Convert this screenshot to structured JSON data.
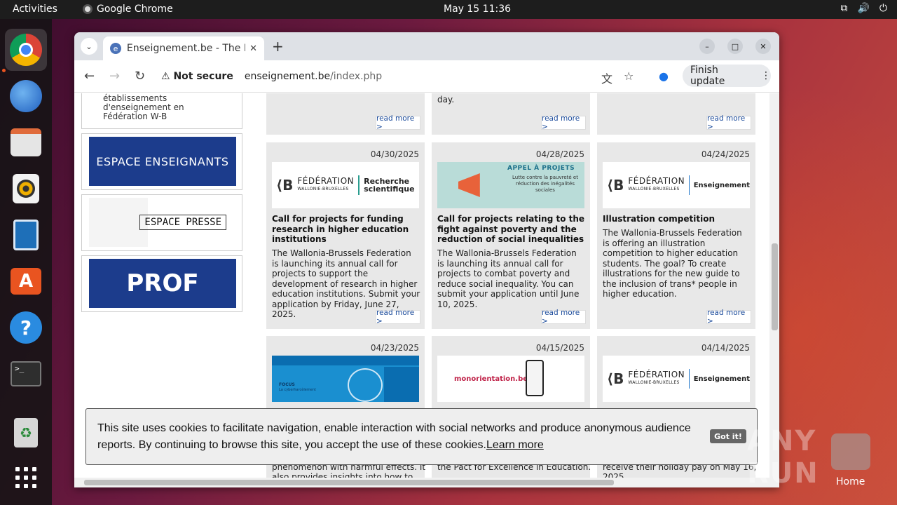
{
  "desktop": {
    "activities": "Activities",
    "app_name": "Google Chrome",
    "clock": "May 15  11:36",
    "home_label": "Home",
    "watermark": "ANY RUN"
  },
  "browser": {
    "tab_title": "Enseignement.be - The E",
    "not_secure": "Not secure",
    "url_domain": "enseignement.be",
    "url_path": "/index.php",
    "finish_update": "Finish update"
  },
  "sidebar": {
    "etablissements": [
      "établissements",
      "d'enseignement en",
      "Fédération W-B"
    ],
    "espace_enseignants": "ESPACE ENSEIGNANTS",
    "espace_presse": "ESPACE PRESSE",
    "prof": "PROF"
  },
  "top_row": {
    "mid_text": "day.",
    "read_more": "read more >"
  },
  "cards": [
    {
      "date": "04/30/2025",
      "logo_left": "FÉDÉRATION",
      "logo_left_sub": "WALLONIE-BRUXELLES",
      "logo_right": "Recherche scientifique",
      "title": "Call for projects for funding research in higher education institutions",
      "text": "The Wallonia-Brussels Federation is launching its annual call for projects to support the development of research in higher education institutions. Submit your application by Friday, June 27, 2025.",
      "read_more": "read more >"
    },
    {
      "date": "04/28/2025",
      "img_title": "APPEL À PROJETS",
      "img_sub": "Lutte contre la pauvreté et réduction des inégalités sociales",
      "title": "Call for projects relating to the fight against poverty and the reduction of social inequalities",
      "text": "The Wallonia-Brussels Federation is launching its annual call for projects to combat poverty and reduce social inequality. You can submit your application until June 10, 2025.",
      "read_more": "read more >"
    },
    {
      "date": "04/24/2025",
      "logo_left": "FÉDÉRATION",
      "logo_left_sub": "WALLONIE-BRUXELLES",
      "logo_right": "Enseignement",
      "title": "Illustration competition",
      "text": "The Wallonia-Brussels Federation is offering an illustration competition to higher education students. The goal? To create illustrations for the new guide to the inclusion of trans* people in higher education.",
      "read_more": "read more >"
    },
    {
      "date": "04/23/2025",
      "img_title": "FOCUS",
      "img_sub": "La cyberharcèlement",
      "bottom_text": [
        "phenomenon with harmful effects. It",
        "also provides insights into how to"
      ]
    },
    {
      "date": "04/15/2025",
      "img_title": "monorientation.be",
      "bottom_text": [
        "the Pact for Excellence in Education."
      ]
    },
    {
      "date": "04/14/2025",
      "logo_left": "FÉDÉRATION",
      "logo_left_sub": "WALLONIE-BRUXELLES",
      "logo_right": "Enseignement",
      "bottom_text": [
        "receive their holiday pay on May 16,",
        "2025."
      ]
    }
  ],
  "cookie": {
    "message": "This site uses cookies to facilitate navigation, enable interaction with social networks and produce anonymous audience reports. By continuing to browse this site, you accept the use of these cookies.",
    "learn_more": "Learn more",
    "button": "Got it!"
  }
}
